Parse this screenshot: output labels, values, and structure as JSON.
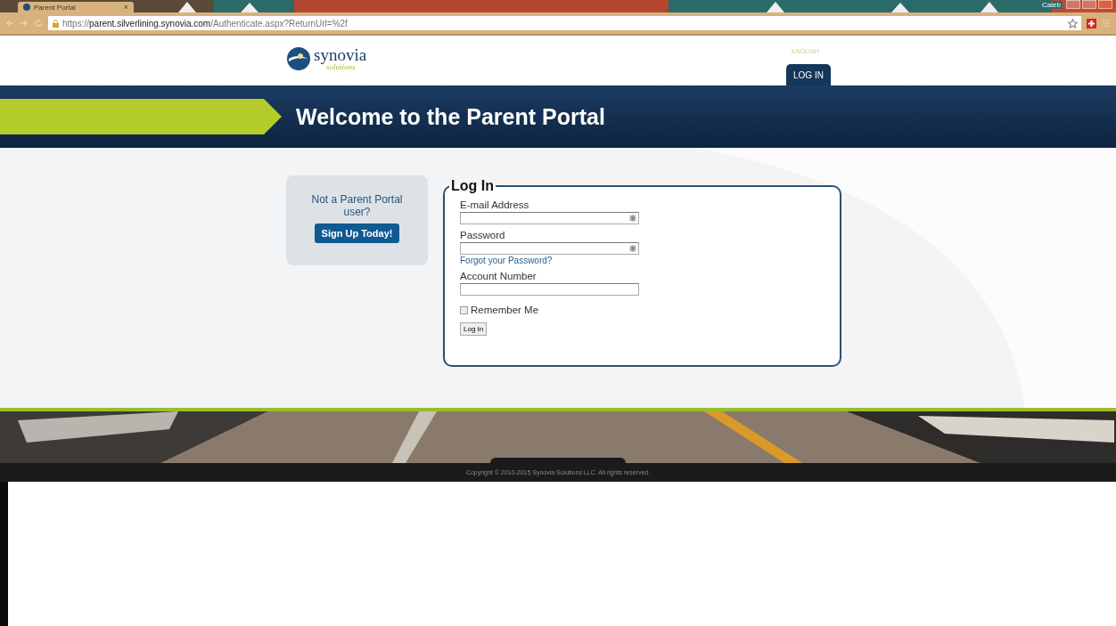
{
  "browser": {
    "tab": {
      "title": "Parent Portal",
      "close": "×"
    },
    "user": "Caleb",
    "url_host_prefix": "https://",
    "url_host": "parent.silverlining.synovia.com",
    "url_path": "/Authenticate.aspx?ReturnUrl=%2f"
  },
  "header": {
    "logo": {
      "name": "synovia",
      "tagline": "solutions"
    },
    "language": "ENGLISH",
    "nav": [
      {
        "label": "LOG IN",
        "selected": true
      }
    ]
  },
  "banner": {
    "title": "Welcome to the Parent Portal"
  },
  "signup": {
    "text": "Not a Parent Portal user?",
    "button": "Sign Up Today!"
  },
  "login": {
    "legend": "Log In",
    "fields": [
      {
        "label": "E-mail Address",
        "required": true
      },
      {
        "label": "Password",
        "required": true,
        "link": "Forgot your Password?"
      },
      {
        "label": "Account Number",
        "required": false
      }
    ],
    "remember": {
      "label": "Remember Me",
      "checked": false
    },
    "button": "Log In"
  },
  "footer": {
    "copyright": "Copyright © 2010-2015 Synovia Solutions LLC. All rights reserved."
  }
}
